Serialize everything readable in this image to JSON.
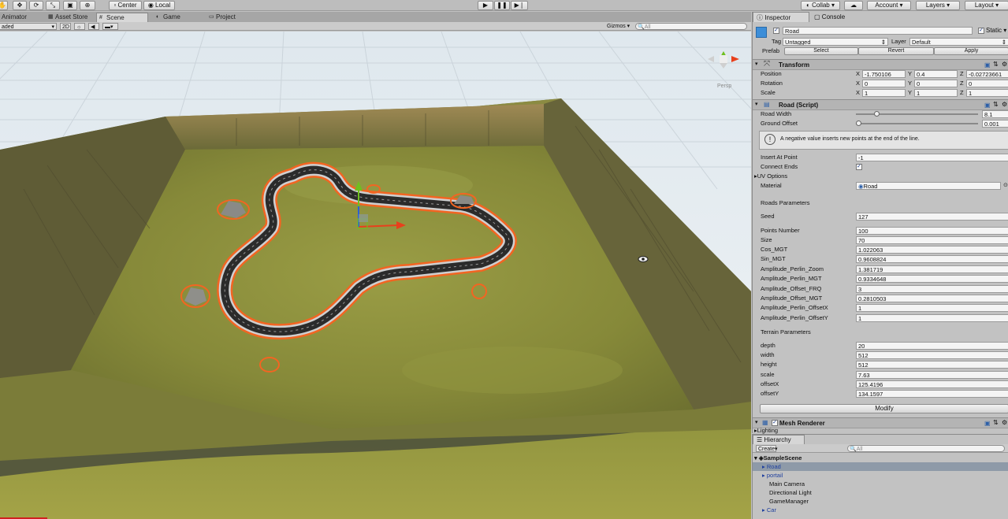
{
  "toolbar": {
    "tools": [
      "hand-tool",
      "move-tool",
      "rotate-tool",
      "scale-tool",
      "rect-tool",
      "transform-tool"
    ],
    "pivot_label": "Center",
    "space_label": "Local",
    "collab_label": "Collab",
    "account_label": "Account",
    "layers_label": "Layers",
    "layout_label": "Layout"
  },
  "tabs": [
    {
      "label": "Animator",
      "icon": "animator-icon"
    },
    {
      "label": "Asset Store",
      "icon": "asset-store-icon"
    },
    {
      "label": "Scene",
      "icon": "scene-icon"
    },
    {
      "label": "Game",
      "icon": "game-icon"
    },
    {
      "label": "Project",
      "icon": "project-icon"
    }
  ],
  "scene_toolbar": {
    "shading_mode": "aded",
    "mode_2d": "2D",
    "gizmos_label": "Gizmos",
    "search_placeholder": "All",
    "persp_label": "Persp"
  },
  "inspector": {
    "tabs": [
      "Inspector",
      "Console"
    ],
    "object_name": "Road",
    "static_label": "Static",
    "tag_label": "Tag",
    "tag_value": "Untagged",
    "layer_label": "Layer",
    "layer_value": "Default",
    "prefab_label": "Prefab",
    "prefab_buttons": [
      "Select",
      "Revert",
      "Apply"
    ],
    "transform": {
      "title": "Transform",
      "position_label": "Position",
      "position": {
        "x": "-1.750106",
        "y": "0.4",
        "z": "-0.02723661"
      },
      "rotation_label": "Rotation",
      "rotation": {
        "x": "0",
        "y": "0",
        "z": "0"
      },
      "scale_label": "Scale",
      "scale": {
        "x": "1",
        "y": "1",
        "z": "1"
      }
    },
    "road_script": {
      "title": "Road (Script)",
      "road_width_label": "Road Width",
      "road_width": "8.1",
      "road_width_fraction": 0.06,
      "ground_offset_label": "Ground Offset",
      "ground_offset": "0.001",
      "ground_offset_fraction": 0.0,
      "info_text": "A negative value inserts new points at the end of the line.",
      "insert_at_point_label": "Insert At Point",
      "insert_at_point": "-1",
      "connect_ends_label": "Connect Ends",
      "uv_options_label": "UV Options",
      "material_label": "Material",
      "material_value": "Road",
      "roads_parameters_label": "Roads Parameters",
      "roads_params": [
        {
          "label": "Seed",
          "value": "127"
        },
        {
          "label": "Points Number",
          "value": "100"
        },
        {
          "label": "Size",
          "value": "70"
        },
        {
          "label": "Cos_MGT",
          "value": "1.022063"
        },
        {
          "label": "Sin_MGT",
          "value": "0.9608824"
        },
        {
          "label": "Amplitude_Perlin_Zoom",
          "value": "1.381719"
        },
        {
          "label": "Amplitude_Perlin_MGT",
          "value": "0.9334648"
        },
        {
          "label": "Amplitude_Offset_FRQ",
          "value": "3"
        },
        {
          "label": "Amplitude_Offset_MGT",
          "value": "0.2810503"
        },
        {
          "label": "Amplitude_Perlin_OffsetX",
          "value": "1"
        },
        {
          "label": "Amplitude_Perlin_OffsetY",
          "value": "1"
        }
      ],
      "terrain_parameters_label": "Terrain Parameters",
      "terrain_params": [
        {
          "label": "depth",
          "value": "20"
        },
        {
          "label": "width",
          "value": "512"
        },
        {
          "label": "height",
          "value": "512"
        },
        {
          "label": "scale",
          "value": "7.63"
        },
        {
          "label": "offsetX",
          "value": "125.4196"
        },
        {
          "label": "offsetY",
          "value": "134.1597"
        }
      ],
      "modify_button": "Modify"
    },
    "mesh_renderer": {
      "title": "Mesh Renderer",
      "lighting_label": "Lighting"
    }
  },
  "hierarchy": {
    "tab_label": "Hierarchy",
    "create_label": "Create",
    "search_placeholder": "All",
    "scene_name": "SampleScene",
    "items": [
      {
        "label": "Road",
        "selected": true,
        "prefab": true,
        "expandable": true
      },
      {
        "label": "portail",
        "selected": false,
        "prefab": true,
        "expandable": true
      },
      {
        "label": "Main Camera",
        "selected": false,
        "prefab": false,
        "expandable": false
      },
      {
        "label": "Directional Light",
        "selected": false,
        "prefab": false,
        "expandable": false
      },
      {
        "label": "GameManager",
        "selected": false,
        "prefab": false,
        "expandable": false
      },
      {
        "label": "Car",
        "selected": false,
        "prefab": true,
        "expandable": true
      }
    ]
  },
  "colors": {
    "selection_outline": "#f26522",
    "road": "#2b2b2b",
    "terrain_grass": "#8a8b3a",
    "sky": "#e6eef2",
    "prefab_text": "#1e3f9e"
  }
}
